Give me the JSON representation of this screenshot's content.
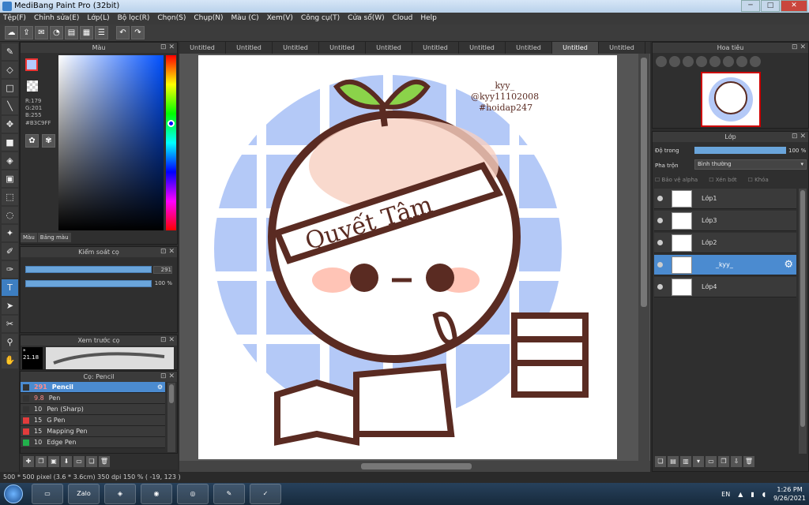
{
  "window": {
    "title": "MediBang Paint Pro (32bit)",
    "min": "─",
    "max": "□",
    "close": "✕"
  },
  "menu": [
    "Tệp(F)",
    "Chỉnh sửa(E)",
    "Lớp(L)",
    "Bộ lọc(R)",
    "Chọn(S)",
    "Chụp(N)",
    "Màu (C)",
    "Xem(V)",
    "Công cụ(T)",
    "Cửa sổ(W)",
    "Cloud",
    "Help"
  ],
  "color_panel": {
    "title": "Màu",
    "r": "R:179",
    "g": "G:201",
    "b": "B:255",
    "hex": "#B3C9FF",
    "tab_color": "Màu",
    "tab_palette": "Bảng màu",
    "current_color": "#b3c9ff"
  },
  "brush_control": {
    "title": "Kiểm soát cọ",
    "size": "291",
    "opacity": "100 %"
  },
  "brush_preview": {
    "title": "Xem trước cọ",
    "value": "21.18"
  },
  "pens": {
    "title": "Cọ: Pencil",
    "items": [
      {
        "size": "291",
        "name": "Pencil",
        "color": "#333333"
      },
      {
        "size": "9.8",
        "name": "Pen",
        "color": "#333333"
      },
      {
        "size": "10",
        "name": "Pen (Sharp)",
        "color": "#333333"
      },
      {
        "size": "15",
        "name": "G Pen",
        "color": "#e23c3c"
      },
      {
        "size": "15",
        "name": "Mapping Pen",
        "color": "#e23c3c"
      },
      {
        "size": "10",
        "name": "Edge Pen",
        "color": "#22b14c"
      }
    ]
  },
  "tabs": [
    "Untitled",
    "Untitled",
    "Untitled",
    "Untitled",
    "Untitled",
    "Untitled",
    "Untitled",
    "Untitled",
    "Untitled",
    "Untitled"
  ],
  "artwork": {
    "banner": "Quyết Tâm",
    "credit1": "_kyy_",
    "credit2": "@kyy11102008",
    "credit3": "#hoidap247"
  },
  "navigator": {
    "title": "Hoa tiêu"
  },
  "layers": {
    "title": "Lớp",
    "opacity_label": "Độ trong",
    "opacity_value": "100 %",
    "blend_label": "Pha trộn",
    "blend_value": "Bình thường",
    "protect_alpha": "Bảo vệ alpha",
    "clip": "Xén bớt",
    "lock": "Khóa",
    "items": [
      "Lớp1",
      "Lớp3",
      "Lớp2",
      "_kyy_",
      "Lớp4"
    ]
  },
  "status": {
    "text": "500 * 500 pixel   (3.6 * 3.6cm)   350 dpi   150 %   ( -19, 123 )"
  },
  "taskbar": {
    "lang": "EN",
    "time": "1:26 PM",
    "date": "9/26/2021",
    "zalo": "Zalo"
  }
}
